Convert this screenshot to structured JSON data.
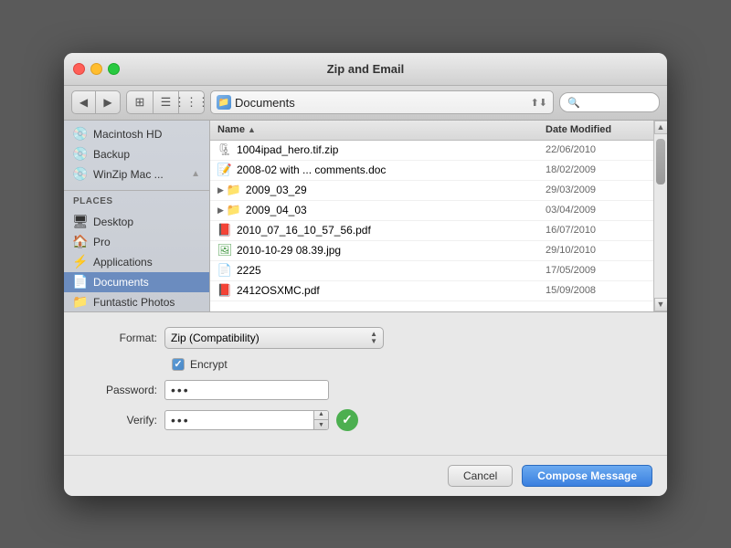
{
  "window": {
    "title": "Zip and Email"
  },
  "toolbar": {
    "location": "Documents",
    "search_placeholder": ""
  },
  "sidebar": {
    "devices": [
      {
        "id": "macintosh-hd",
        "label": "Macintosh HD",
        "icon": "💿"
      },
      {
        "id": "backup",
        "label": "Backup",
        "icon": "💿"
      },
      {
        "id": "winzip-mac",
        "label": "WinZip Mac ...",
        "icon": "💿"
      }
    ],
    "places_header": "PLACES",
    "places": [
      {
        "id": "desktop",
        "label": "Desktop",
        "icon": "🖥"
      },
      {
        "id": "pro",
        "label": "Pro",
        "icon": "🏠"
      },
      {
        "id": "applications",
        "label": "Applications",
        "icon": "📁"
      },
      {
        "id": "documents",
        "label": "Documents",
        "icon": "📄",
        "selected": true
      },
      {
        "id": "fantastical",
        "label": "Funtastic Photos",
        "icon": "📁"
      }
    ]
  },
  "file_list": {
    "col_name": "Name",
    "col_date": "Date Modified",
    "files": [
      {
        "name": "1004ipad_hero.tif.zip",
        "date": "22/06/2010",
        "type": "zip",
        "expandable": false
      },
      {
        "name": "2008-02 with ... comments.doc",
        "date": "18/02/2009",
        "type": "doc",
        "expandable": false
      },
      {
        "name": "2009_03_29",
        "date": "29/03/2009",
        "type": "folder",
        "expandable": true
      },
      {
        "name": "2009_04_03",
        "date": "03/04/2009",
        "type": "folder",
        "expandable": true
      },
      {
        "name": "2010_07_16_10_57_56.pdf",
        "date": "16/07/2010",
        "type": "pdf",
        "expandable": false
      },
      {
        "name": "2010-10-29 08.39.jpg",
        "date": "29/10/2010",
        "type": "img",
        "expandable": false
      },
      {
        "name": "2225",
        "date": "17/05/2009",
        "type": "file",
        "expandable": false
      },
      {
        "name": "2412OSXMC.pdf",
        "date": "15/09/2008",
        "type": "pdf",
        "expandable": false
      }
    ]
  },
  "form": {
    "format_label": "Format:",
    "format_value": "Zip (Compatibility)",
    "encrypt_label": "Encrypt",
    "encrypt_checked": true,
    "password_label": "Password:",
    "password_value": "•••",
    "verify_label": "Verify:",
    "verify_value": "•••"
  },
  "footer": {
    "cancel_label": "Cancel",
    "compose_label": "Compose Message"
  }
}
